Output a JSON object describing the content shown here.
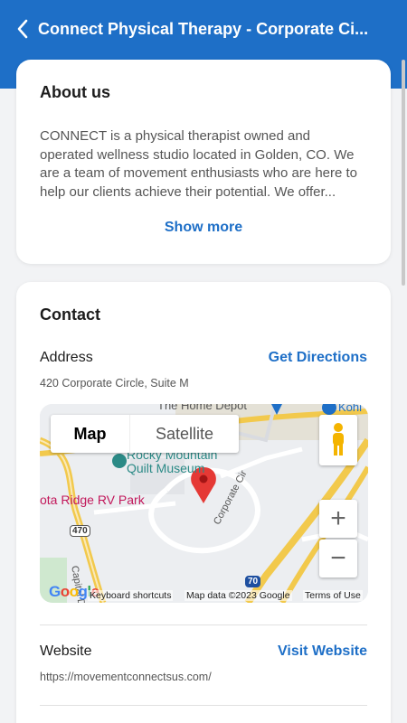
{
  "header": {
    "title": "Connect Physical Therapy - Corporate Ci...",
    "back_icon": "chevron-left-icon",
    "color": "#1e6fc7"
  },
  "about": {
    "title": "About us",
    "text": "CONNECT is a physical therapist owned and operated wellness studio located in Golden, CO.  We are a team of movement enthusiasts who are here to help our clients achieve their potential.  We offer...",
    "show_more": "Show more"
  },
  "contact": {
    "title": "Contact",
    "address": {
      "label": "Address",
      "link": "Get Directions",
      "value": "420 Corporate Circle, Suite M"
    },
    "map": {
      "type_map": "Map",
      "type_satellite": "Satellite",
      "labels": {
        "depot": "The Home Depot",
        "kohls": "Kohl",
        "museum_line1": "Rocky Mountain",
        "museum_line2": "Quilt Museum",
        "rv_park": "ota Ridge RV Park",
        "corporate_cir": "Corporate Cir",
        "capital_dr": "Capital Dr",
        "shield_470": "470",
        "shield_70": "70"
      },
      "google": "Google",
      "keyboard_shortcuts": "Keyboard shortcuts",
      "map_data": "Map data ©2023 Google",
      "terms": "Terms of Use",
      "zoom_in": "+",
      "zoom_out": "−"
    },
    "website": {
      "label": "Website",
      "link": "Visit Website",
      "value": "https://movementconnectsus.com/"
    }
  }
}
